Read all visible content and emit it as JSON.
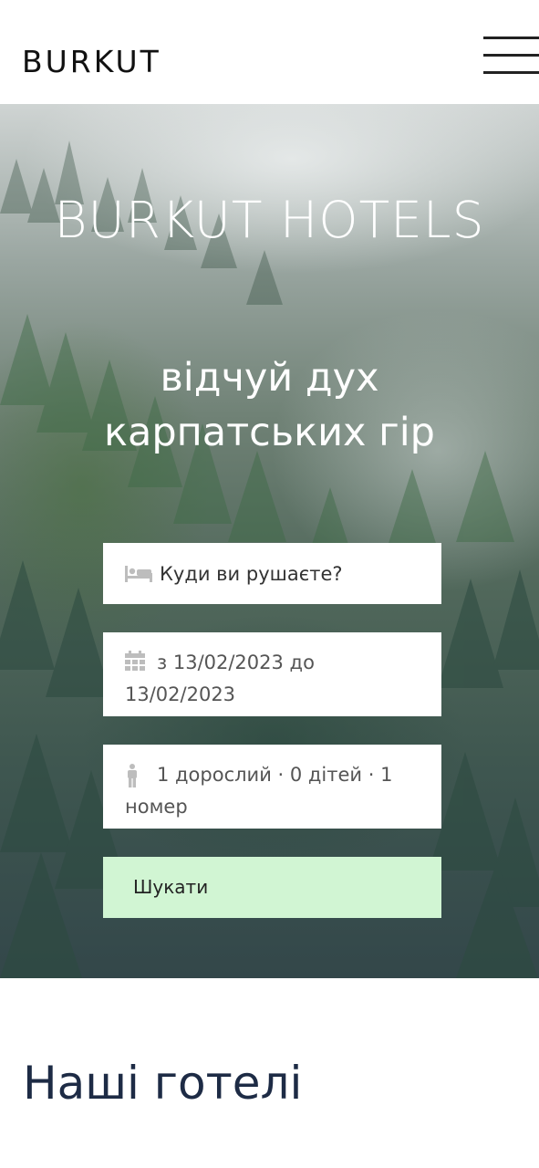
{
  "header": {
    "logo": "BURKUT",
    "menu_icon": "hamburger-menu-icon"
  },
  "hero": {
    "title": "BURKUT HOTELS",
    "tagline": "відчуй дух карпатських гір",
    "background": "misty-forest-photo"
  },
  "search_form": {
    "destination": {
      "icon": "bed-icon",
      "placeholder": "Куди ви рушаєте?"
    },
    "dates": {
      "icon": "calendar-icon",
      "value": "з 13/02/2023 до 13/02/2023"
    },
    "guests": {
      "icon": "person-icon",
      "value": "1 дорослий · 0 дітей · 1 номер"
    },
    "search_label": "Шукати"
  },
  "sections": {
    "hotels_title": "Наші готелі"
  },
  "colors": {
    "search_button_bg": "#d1f5d3",
    "section_title": "#1d2b45",
    "logo": "#111111"
  }
}
